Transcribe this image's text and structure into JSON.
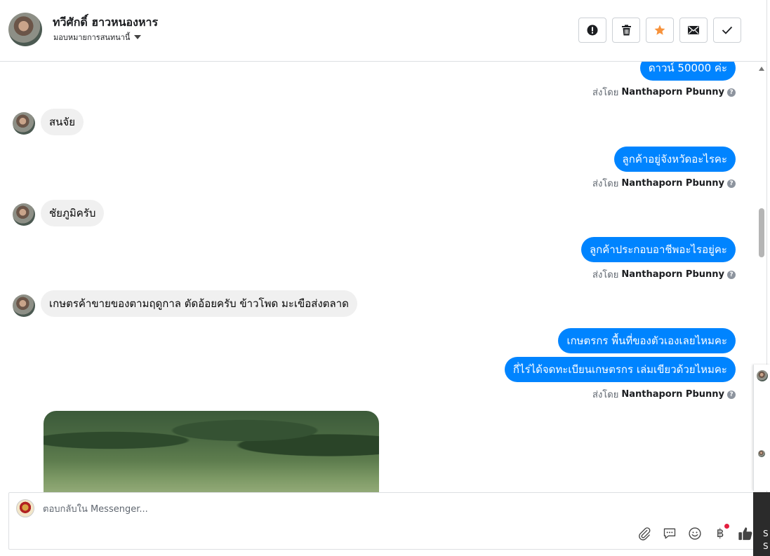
{
  "header": {
    "contact_name": "ทวีศักดิ์ ฮาวหนองหาร",
    "assign_label": "มอบหมายการสนทนานี้"
  },
  "actions": [
    {
      "name": "mark-spam-button",
      "icon": "exclamation-circle-icon"
    },
    {
      "name": "delete-button",
      "icon": "trash-icon"
    },
    {
      "name": "star-button",
      "icon": "star-icon",
      "color": "#f7923b"
    },
    {
      "name": "mark-unread-button",
      "icon": "envelope-icon"
    },
    {
      "name": "mark-done-button",
      "icon": "check-icon"
    }
  ],
  "messages": [
    {
      "dir": "out",
      "text": "ดาวน์ 50000 ค่ะ"
    },
    {
      "dir": "sent_by",
      "prefix": "ส่งโดย",
      "name": "Nanthaporn Pbunny"
    },
    {
      "dir": "in",
      "text": "สนจัย"
    },
    {
      "dir": "out",
      "text": "ลูกค้าอยู่จังหวัดอะไรคะ"
    },
    {
      "dir": "sent_by",
      "prefix": "ส่งโดย",
      "name": "Nanthaporn Pbunny"
    },
    {
      "dir": "in",
      "text": "ชัยภูมิครับ"
    },
    {
      "dir": "out",
      "text": "ลูกค้าประกอบอาชีพอะไรอยู่คะ"
    },
    {
      "dir": "sent_by",
      "prefix": "ส่งโดย",
      "name": "Nanthaporn Pbunny"
    },
    {
      "dir": "in",
      "text": "เกษตรค้าขายของตามฤดูกาล ตัดอ้อยครับ ข้าวโพด มะเขือส่งตลาด"
    },
    {
      "dir": "out",
      "text": "เกษตรกร พื้นที่ของตัวเองเลยไหมคะ"
    },
    {
      "dir": "out",
      "text": "กี่ไร่ได้จดทะเบียนเกษตรกร เล่มเขียวด้วยไหมคะ"
    },
    {
      "dir": "sent_by",
      "prefix": "ส่งโดย",
      "name": "Nanthaporn Pbunny"
    }
  ],
  "composer": {
    "placeholder": "ตอบกลับใน Messenger..."
  },
  "tools": [
    "paperclip-icon",
    "saved-reply-icon",
    "emoji-icon",
    "baht-payment-icon",
    "thumbs-up-icon"
  ],
  "colors": {
    "outgoing_bubble": "#0084ff",
    "incoming_bubble": "#f0f0f0",
    "like_blue": "#0084ff"
  },
  "side_panel": {
    "line1": "S",
    "line2": "S"
  }
}
